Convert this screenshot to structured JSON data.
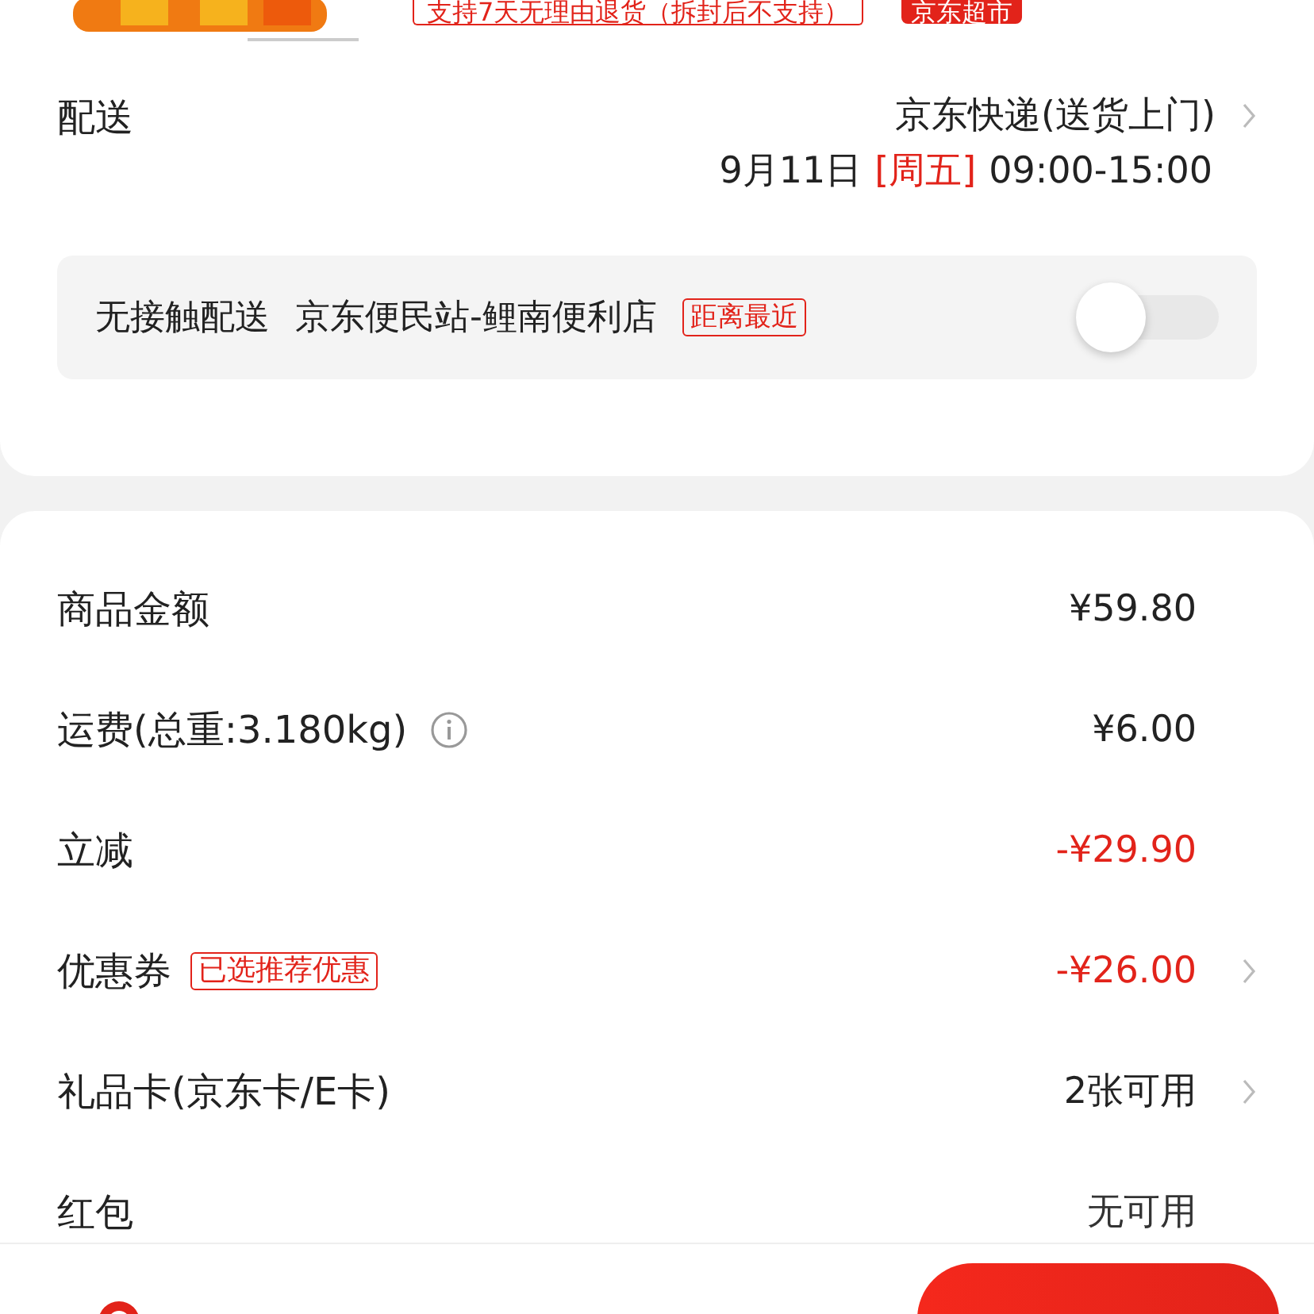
{
  "product": {
    "kind": "picture",
    "service_note": "支持7天无理由退货（拆封后不支持）",
    "store_tag": "京东超市"
  },
  "delivery": {
    "label": "配送",
    "method": "京东快递(送货上门)",
    "date": "9月11日",
    "weekday": "[周五]",
    "time": "09:00-15:00",
    "contactless": {
      "label": "无接触配送",
      "station": "京东便民站-鲤南便利店",
      "tag": "距离最近",
      "on": false
    }
  },
  "summary": [
    {
      "label": "商品金额",
      "value": "¥59.80",
      "kind": "plain",
      "info": false,
      "chevron": false
    },
    {
      "label": "运费(总重:3.180kg)",
      "value": "¥6.00",
      "kind": "plain",
      "info": true,
      "chevron": false
    },
    {
      "label": "立减",
      "value": "-¥29.90",
      "kind": "discount",
      "info": false,
      "chevron": false
    },
    {
      "label": "优惠券",
      "tag": "已选推荐优惠",
      "value": "-¥26.00",
      "kind": "discount",
      "info": false,
      "chevron": true
    },
    {
      "label": "礼品卡(京东卡/E卡)",
      "value": "2张可用",
      "kind": "plain",
      "info": false,
      "chevron": true
    },
    {
      "label": "红包",
      "value": "无可用",
      "kind": "muted",
      "info": false,
      "chevron": false
    }
  ]
}
